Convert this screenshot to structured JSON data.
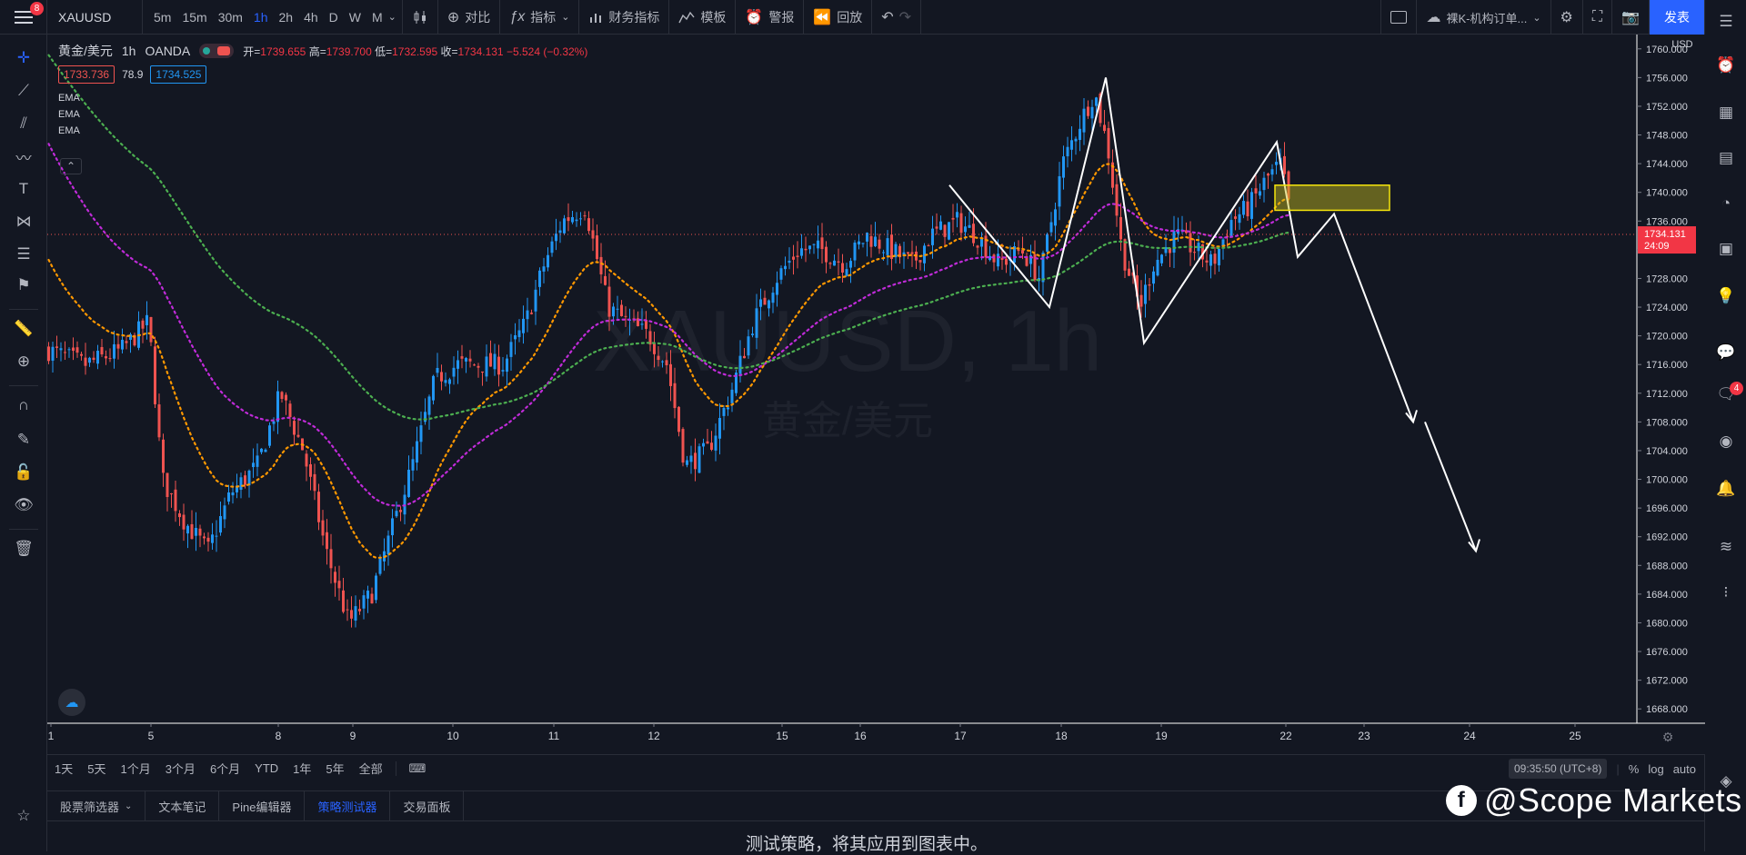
{
  "topbar": {
    "menu_badge": "8",
    "symbol": "XAUUSD",
    "intervals": [
      "5m",
      "15m",
      "30m",
      "1h",
      "2h",
      "4h",
      "D",
      "W",
      "M"
    ],
    "active_interval": "1h",
    "compare_label": "对比",
    "indicators_label": "指标",
    "financials_label": "财务指标",
    "templates_label": "模板",
    "alert_label": "警报",
    "replay_label": "回放",
    "layout_name": "裸K-机构订单...",
    "publish_label": "发表"
  },
  "legend": {
    "name": "黄金/美元",
    "interval": "1h",
    "source": "OANDA",
    "open_label": "开=",
    "open": "1739.655",
    "high_label": "高=",
    "high": "1739.700",
    "low_label": "低=",
    "low": "1732.595",
    "close_label": "收=",
    "close": "1734.131",
    "change": "−5.524 (−0.32%)",
    "bid": "1733.736",
    "spread": "78.9",
    "ask": "1734.525",
    "ema_labels": [
      "EMA",
      "EMA",
      "EMA"
    ]
  },
  "watermark": {
    "line1": "XAUUSD, 1h",
    "line2": "黄金/美元"
  },
  "price_axis": {
    "currency": "USD",
    "ticks": [
      "1760.000",
      "1756.000",
      "1752.000",
      "1748.000",
      "1744.000",
      "1740.000",
      "1736.000",
      "1732.000",
      "1728.000",
      "1724.000",
      "1720.000",
      "1716.000",
      "1712.000",
      "1708.000",
      "1704.000",
      "1700.000",
      "1696.000",
      "1692.000",
      "1688.000",
      "1684.000",
      "1680.000",
      "1676.000",
      "1672.000",
      "1668.000"
    ],
    "current_price": "1734.131",
    "countdown": "24:09"
  },
  "time_axis": {
    "ticks": [
      "1",
      "5",
      "8",
      "9",
      "10",
      "11",
      "12",
      "15",
      "16",
      "17",
      "18",
      "19",
      "22",
      "23",
      "24",
      "25"
    ]
  },
  "ranges": {
    "items": [
      "1天",
      "5天",
      "1个月",
      "3个月",
      "6个月",
      "YTD",
      "1年",
      "5年",
      "全部"
    ],
    "time": "09:35:50 (UTC+8)",
    "percent": "%",
    "log": "log",
    "auto": "auto"
  },
  "bottom_tabs": {
    "items": [
      "股票筛选器",
      "文本笔记",
      "Pine编辑器",
      "策略测试器",
      "交易面板"
    ],
    "active": "策略测试器",
    "message": "测试策略，将其应用到图表中。"
  },
  "brand": {
    "text": "@Scope Markets"
  },
  "right_toolbar": {
    "chat_badge": "4"
  },
  "colors": {
    "background": "#131722",
    "up": "#2196f3",
    "down": "#ef5350",
    "ema_green": "#4caf50",
    "ema_purple": "#c02bd9",
    "ema_orange": "#ff9800",
    "accent": "#2962ff"
  },
  "chart_data": {
    "type": "candlestick",
    "symbol": "XAUUSD",
    "interval": "1h",
    "ylim": [
      1666,
      1762
    ],
    "ema_series": [
      "EMA",
      "EMA",
      "EMA"
    ],
    "current_price": 1734.131
  }
}
